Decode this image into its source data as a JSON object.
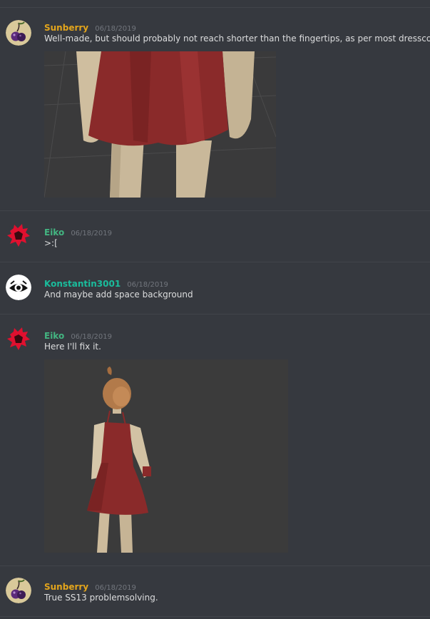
{
  "messages": [
    {
      "username": "Sunberry",
      "username_color": "#e3a51c",
      "timestamp": "06/18/2019",
      "text": "Well-made, but should probably not reach shorter than the fingertips, as per most dresscodes.",
      "avatar": "cherry-avatar-icon",
      "attachment": "skirt-closeup-render-image"
    },
    {
      "username": "Eiko",
      "username_color": "#43b581",
      "timestamp": "06/18/2019",
      "text": ">:[",
      "avatar": "red-splash-avatar-icon"
    },
    {
      "username": "Konstantin3001",
      "username_color": "#1abc9c",
      "timestamp": "06/18/2019",
      "text": "And maybe add space background",
      "avatar": "eye-avatar-icon"
    },
    {
      "username": "Eiko",
      "username_color": "#43b581",
      "timestamp": "06/18/2019",
      "text": "Here I'll fix it.",
      "avatar": "red-splash-avatar-icon",
      "attachment": "character-full-render-image"
    },
    {
      "username": "Sunberry",
      "username_color": "#e3a51c",
      "timestamp": "06/18/2019",
      "text": "True SS13 problemsolving.",
      "avatar": "cherry-avatar-icon"
    }
  ]
}
